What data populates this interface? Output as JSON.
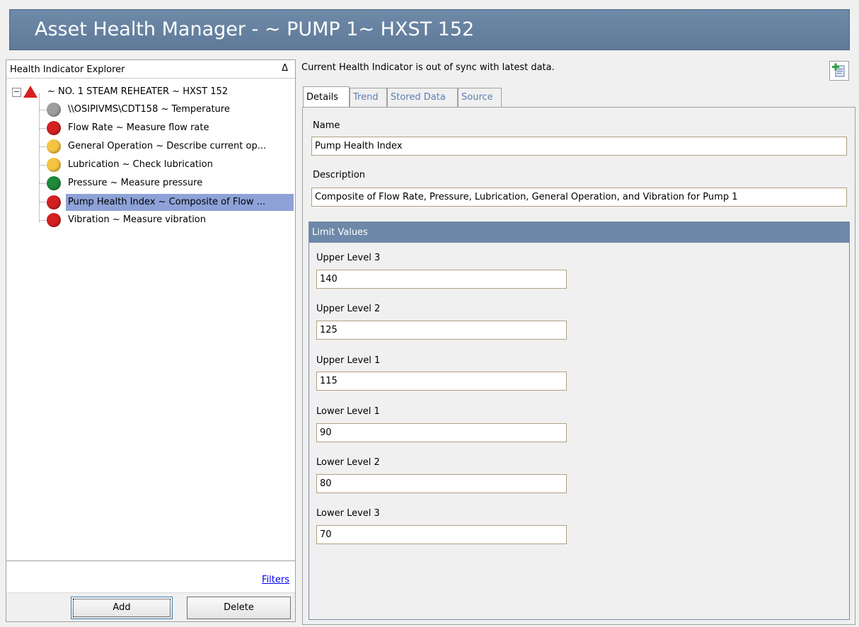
{
  "window": {
    "title": "Asset Health Manager -  ~ PUMP 1~ HXST 152"
  },
  "explorer": {
    "title": "Health Indicator Explorer",
    "collapse_glyph": "Δ",
    "root": {
      "expander": "−",
      "status": "red-triangle",
      "label": "~ NO. 1 STEAM REHEATER ~ HXST 152"
    },
    "items": [
      {
        "label": "\\\\OSIPIVMS\\CDT158 ~ Temperature",
        "status": "gray",
        "color": "#9e9e9e"
      },
      {
        "label": "Flow Rate ~ Measure flow rate",
        "status": "red",
        "color": "#d42020"
      },
      {
        "label": "General Operation ~ Describe current op...",
        "status": "yellow",
        "color": "#f5c542"
      },
      {
        "label": "Lubrication ~ Check lubrication",
        "status": "yellow",
        "color": "#f5c542"
      },
      {
        "label": "Pressure ~ Measure pressure",
        "status": "green",
        "color": "#1f8a3a"
      },
      {
        "label": "Pump Health Index ~ Composite of Flow ...",
        "status": "red",
        "color": "#d42020",
        "selected": true
      },
      {
        "label": "Vibration ~ Measure vibration",
        "status": "red",
        "color": "#d42020"
      }
    ],
    "filters_label": "Filters",
    "add_label": "Add",
    "delete_label": "Delete"
  },
  "main": {
    "sync_message": "Current Health Indicator is out of sync with latest data.",
    "tabs": [
      {
        "label": "Details",
        "active": true
      },
      {
        "label": "Trend"
      },
      {
        "label": "Stored Data"
      },
      {
        "label": "Source"
      }
    ],
    "name_label": "Name",
    "name_value": "Pump Health Index",
    "description_label": "Description",
    "description_value": "Composite of Flow Rate, Pressure, Lubrication, General Operation, and Vibration for Pump 1",
    "limit_values": {
      "header": "Limit Values",
      "fields": [
        {
          "label": "Upper Level 3",
          "value": "140"
        },
        {
          "label": "Upper Level 2",
          "value": "125"
        },
        {
          "label": "Upper Level 1",
          "value": "115"
        },
        {
          "label": "Lower Level 1",
          "value": "90"
        },
        {
          "label": "Lower Level 2",
          "value": "80"
        },
        {
          "label": "Lower Level 3",
          "value": "70"
        }
      ]
    }
  },
  "colors": {
    "title_bar": "#6e8aa8",
    "selection": "#8ea2d8",
    "tab_inactive_text": "#5d7eb3",
    "link": "#0000ee"
  }
}
